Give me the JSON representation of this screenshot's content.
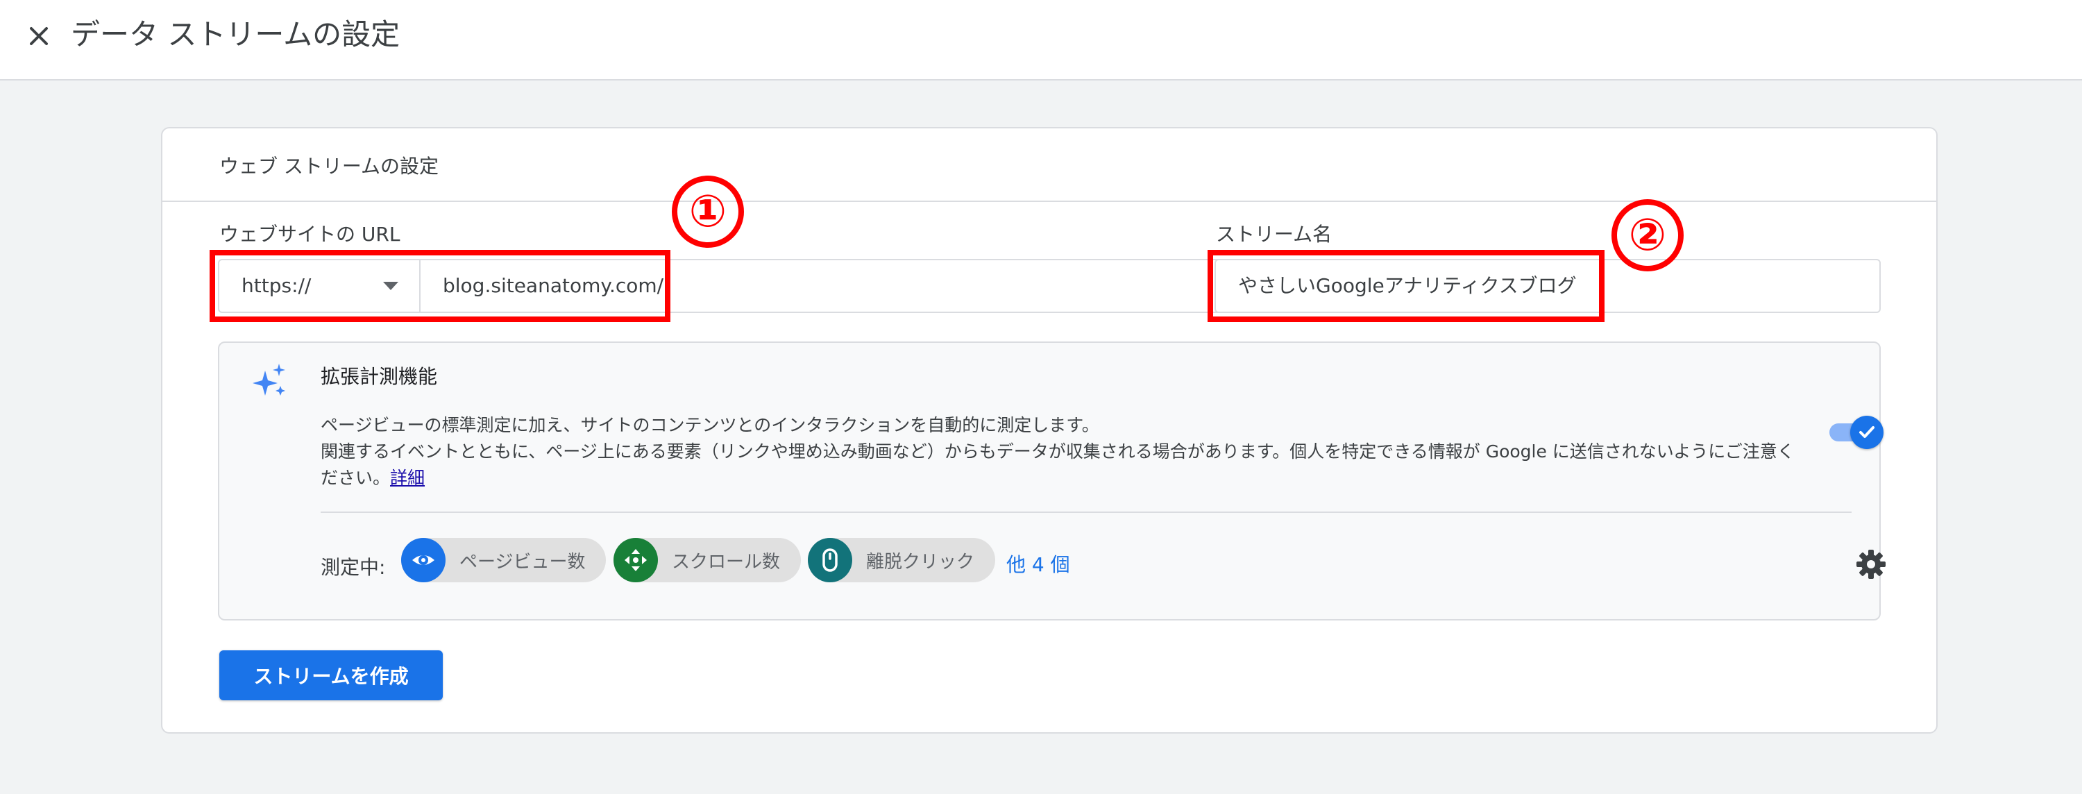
{
  "header": {
    "close_icon": "close-icon",
    "title": "データ ストリームの設定"
  },
  "card": {
    "title": "ウェブ ストリームの設定"
  },
  "website_url": {
    "label": "ウェブサイトの URL",
    "protocol_value": "https://",
    "url_value": "blog.siteanatomy.com/"
  },
  "stream_name": {
    "label": "ストリーム名",
    "value": "やさしいGoogleアナリティクスブログ"
  },
  "annotations": {
    "marker_1": "①",
    "marker_2": "②",
    "highlight_color": "#ff0000"
  },
  "enhanced_measurement": {
    "icon": "sparkle-icon",
    "title": "拡張計測機能",
    "description_line1": "ページビューの標準測定に加え、サイトのコンテンツとのインタラクションを自動的に測定します。",
    "description_line2": "関連するイベントとともに、ページ上にある要素（リンクや埋め込み動画など）からもデータが収集される場合があります。個人を特定できる情報が Google に送信されないようにご注意く",
    "description_line3": "ださい。",
    "detail_link": "詳細",
    "enabled": true,
    "measuring_label": "測定中:",
    "chips": [
      {
        "label": "ページビュー数",
        "icon": "eye-icon",
        "color": "#1a73e8"
      },
      {
        "label": "スクロール数",
        "icon": "scroll-arrows-icon",
        "color": "#188038"
      },
      {
        "label": "離脱クリック",
        "icon": "mouse-icon",
        "color": "#12737a"
      }
    ],
    "more_link": "他 4 個",
    "settings_icon": "gear-icon"
  },
  "actions": {
    "create_label": "ストリームを作成"
  },
  "colors": {
    "accent": "#1a73e8",
    "background": "#f1f3f4"
  }
}
